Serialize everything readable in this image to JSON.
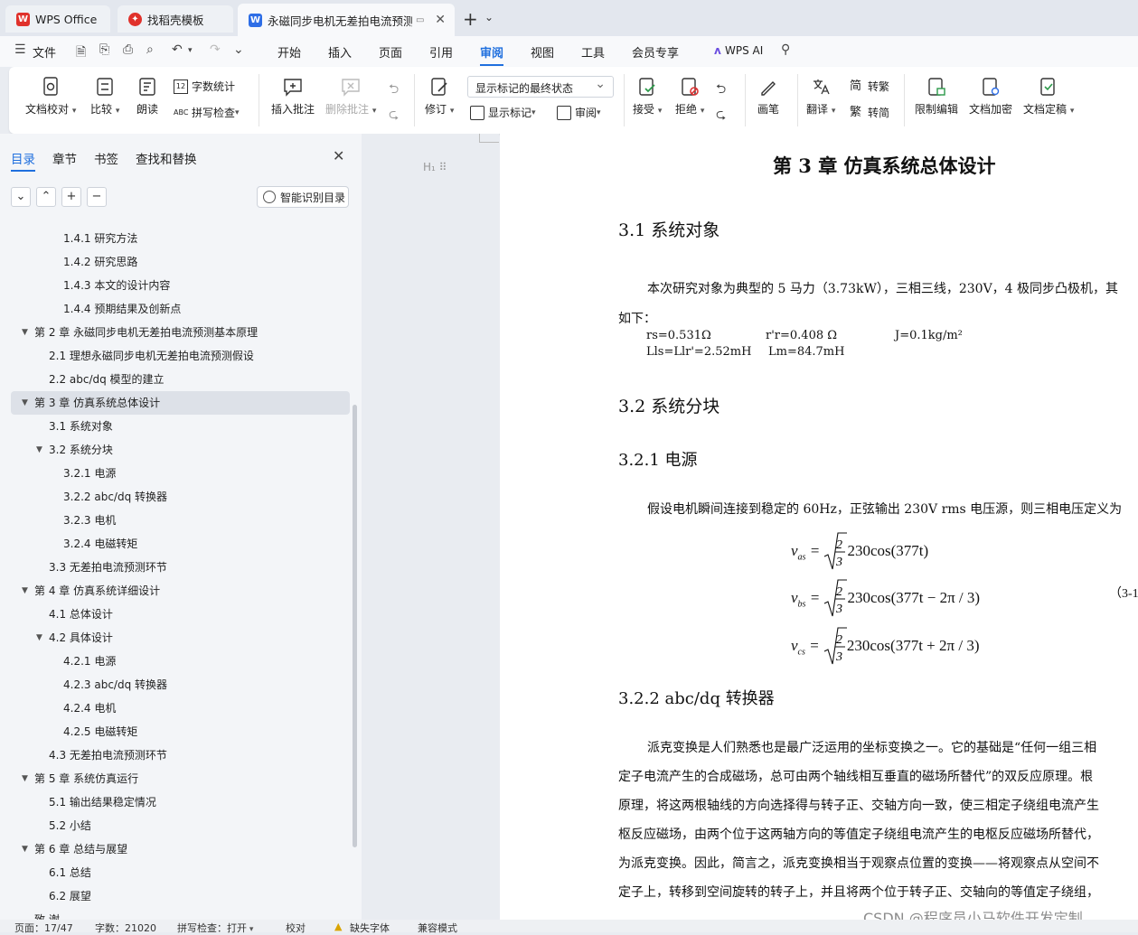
{
  "titlebar": {
    "tabs": [
      {
        "label": "WPS Office",
        "icon": "wps-logo-icon"
      },
      {
        "label": "找稻壳模板",
        "icon": "docer-icon"
      },
      {
        "label": "永磁同步电机无差拍电流预测",
        "icon": "word-doc-icon"
      }
    ]
  },
  "menubar": {
    "file_label": "文件",
    "items": [
      "开始",
      "插入",
      "页面",
      "引用",
      "审阅",
      "视图",
      "工具",
      "会员专享"
    ],
    "active": "审阅",
    "wps_ai": "WPS AI"
  },
  "ribbon": {
    "proofread": "文档校对",
    "compare": "比较",
    "read_aloud": "朗读",
    "word_count": "字数统计",
    "spell_check": "拼写检查",
    "insert_comment": "插入批注",
    "delete_comment": "删除批注",
    "track_changes": "修订",
    "mark_state": "显示标记的最终状态",
    "show_markup": "显示标记",
    "review": "审阅",
    "accept": "接受",
    "reject": "拒绝",
    "pen": "画笔",
    "translate": "翻译",
    "to_traditional": "转繁",
    "to_simplified": "转简",
    "restrict_edit": "限制编辑",
    "encrypt": "文档加密",
    "finalize": "文档定稿"
  },
  "sidebar": {
    "tabs": [
      "目录",
      "章节",
      "书签",
      "查找和替换"
    ],
    "smart_toc": "智能识别目录",
    "toc": [
      {
        "label": "1.4.1  研究方法",
        "level": 3,
        "arrow": ""
      },
      {
        "label": "1.4.2  研究思路",
        "level": 3,
        "arrow": ""
      },
      {
        "label": "1.4.3  本文的设计内容",
        "level": 3,
        "arrow": ""
      },
      {
        "label": "1.4.4  预期结果及创新点",
        "level": 3,
        "arrow": ""
      },
      {
        "label": "第 2 章  永磁同步电机无差拍电流预测基本原理",
        "level": 1,
        "arrow": "▼"
      },
      {
        "label": "2.1 理想永磁同步电机无差拍电流预测假设",
        "level": 2,
        "arrow": ""
      },
      {
        "label": "2.2 abc/dq 模型的建立",
        "level": 2,
        "arrow": ""
      },
      {
        "label": "第 3 章  仿真系统总体设计",
        "level": 1,
        "arrow": "▼",
        "selected": true
      },
      {
        "label": "3.1 系统对象",
        "level": 2,
        "arrow": ""
      },
      {
        "label": "3.2 系统分块",
        "level": 2,
        "arrow": "▼"
      },
      {
        "label": "3.2.1 电源",
        "level": 3,
        "arrow": ""
      },
      {
        "label": "3.2.2 abc/dq 转换器",
        "level": 3,
        "arrow": ""
      },
      {
        "label": "3.2.3 电机",
        "level": 3,
        "arrow": ""
      },
      {
        "label": "3.2.4 电磁转矩",
        "level": 3,
        "arrow": ""
      },
      {
        "label": "3.3 无差拍电流预测环节",
        "level": 2,
        "arrow": ""
      },
      {
        "label": "第 4 章  仿真系统详细设计",
        "level": 1,
        "arrow": "▼"
      },
      {
        "label": "4.1 总体设计",
        "level": 2,
        "arrow": ""
      },
      {
        "label": "4.2 具体设计",
        "level": 2,
        "arrow": "▼"
      },
      {
        "label": "4.2.1 电源",
        "level": 3,
        "arrow": ""
      },
      {
        "label": "4.2.3 abc/dq 转换器",
        "level": 3,
        "arrow": ""
      },
      {
        "label": "4.2.4 电机",
        "level": 3,
        "arrow": ""
      },
      {
        "label": "4.2.5 电磁转矩",
        "level": 3,
        "arrow": ""
      },
      {
        "label": "4.3 无差拍电流预测环节",
        "level": 2,
        "arrow": ""
      },
      {
        "label": "第 5 章  系统仿真运行",
        "level": 1,
        "arrow": "▼"
      },
      {
        "label": "5.1 输出结果稳定情况",
        "level": 2,
        "arrow": ""
      },
      {
        "label": "5.2 小结",
        "level": 2,
        "arrow": ""
      },
      {
        "label": "第 6 章  总结与展望",
        "level": 1,
        "arrow": "▼"
      },
      {
        "label": "6.1 总结",
        "level": 2,
        "arrow": ""
      },
      {
        "label": "6.2 展望",
        "level": 2,
        "arrow": ""
      },
      {
        "label": "致  谢",
        "level": 1,
        "arrow": ""
      }
    ]
  },
  "document": {
    "chapter_title": "第 3 章  仿真系统总体设计",
    "sec_3_1": "3.1 系统对象",
    "para_3_1": "本次研究对象为典型的 5 马力（3.73kW），三相三线，230V，4 极同步凸极机，其",
    "para_3_1b": "如下：",
    "params": {
      "rs": "rs=0.531Ω",
      "rr": "r'r=0.408 Ω",
      "J": "J=0.1kg/m²",
      "L": "Lls=Llr'=2.52mH",
      "Lm": "Lm=84.7mH"
    },
    "sec_3_2": "3.2 系统分块",
    "sec_3_2_1": "3.2.1 电源",
    "para_3_2_1": "假设电机瞬间连接到稳定的 60Hz，正弦输出 230V rms 电压源，则三相电压定义为",
    "formulas": {
      "va": "230cos(377t)",
      "vb": "230cos(377t − 2π / 3)",
      "vc": "230cos(377t + 2π / 3)",
      "eq_number": "（3-1"
    },
    "sec_3_2_2": "3.2.2 abc/dq 转换器",
    "para_3_2_2": [
      "派克变换是人们熟悉也是最广泛运用的坐标变换之一。它的基础是“任何一组三相",
      "定子电流产生的合成磁场，总可由两个轴线相互垂直的磁场所替代”的双反应原理。根",
      "原理，将这两根轴线的方向选择得与转子正、交轴方向一致，使三相定子绕组电流产生",
      "枢反应磁场，由两个位于这两轴方向的等值定子绕组电流产生的电枢反应磁场所替代，",
      "为派克变换。因此，简言之，派克变换相当于观察点位置的变换——将观察点从空间不",
      "定子上，转移到空间旋转的转子上，并且将两个位于转子正、交轴向的等值定子绕组，"
    ]
  },
  "statusbar": {
    "page": "页面：17/47",
    "words": "字数：21020",
    "spell": "拼写检查：打开",
    "proof": "校对",
    "missing_font": "缺失字体",
    "compat": "兼容模式"
  },
  "watermark": "CSDN @程序员小马软件开发定制"
}
